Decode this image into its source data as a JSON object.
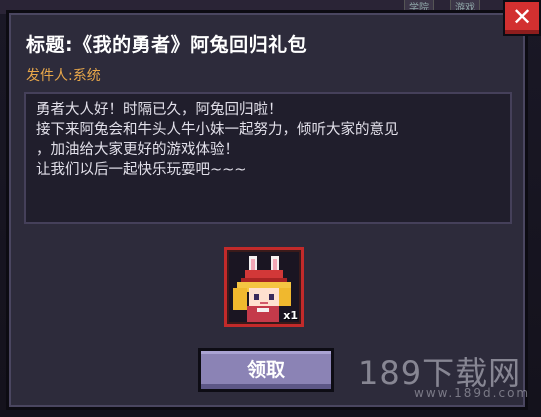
{
  "mail": {
    "title": "标题:《我的勇者》阿兔回归礼包",
    "sender": "发件人:系统",
    "body_lines": [
      "勇者大人好！时隔已久，阿兔回归啦！",
      "接下来阿兔会和牛头人牛小妹一起努力，倾听大家的意见",
      "，加油给大家更好的游戏体验！",
      "让我们以后一起快乐玩耍吧~~~"
    ]
  },
  "attachment": {
    "icon": "bunny-girl-character-icon",
    "count": "x1"
  },
  "buttons": {
    "claim_label": "领取",
    "close_glyph": "✕"
  },
  "background_tags": [
    "学院",
    "游戏"
  ],
  "watermark": {
    "main": "189下载网",
    "sub": "www.189d.com"
  },
  "colors": {
    "panel": "#2d2b3b",
    "sender": "#e8a74a",
    "claim_button": "#8b83b5",
    "close_button": "#d23030",
    "slot_border": "#c22a2a"
  }
}
